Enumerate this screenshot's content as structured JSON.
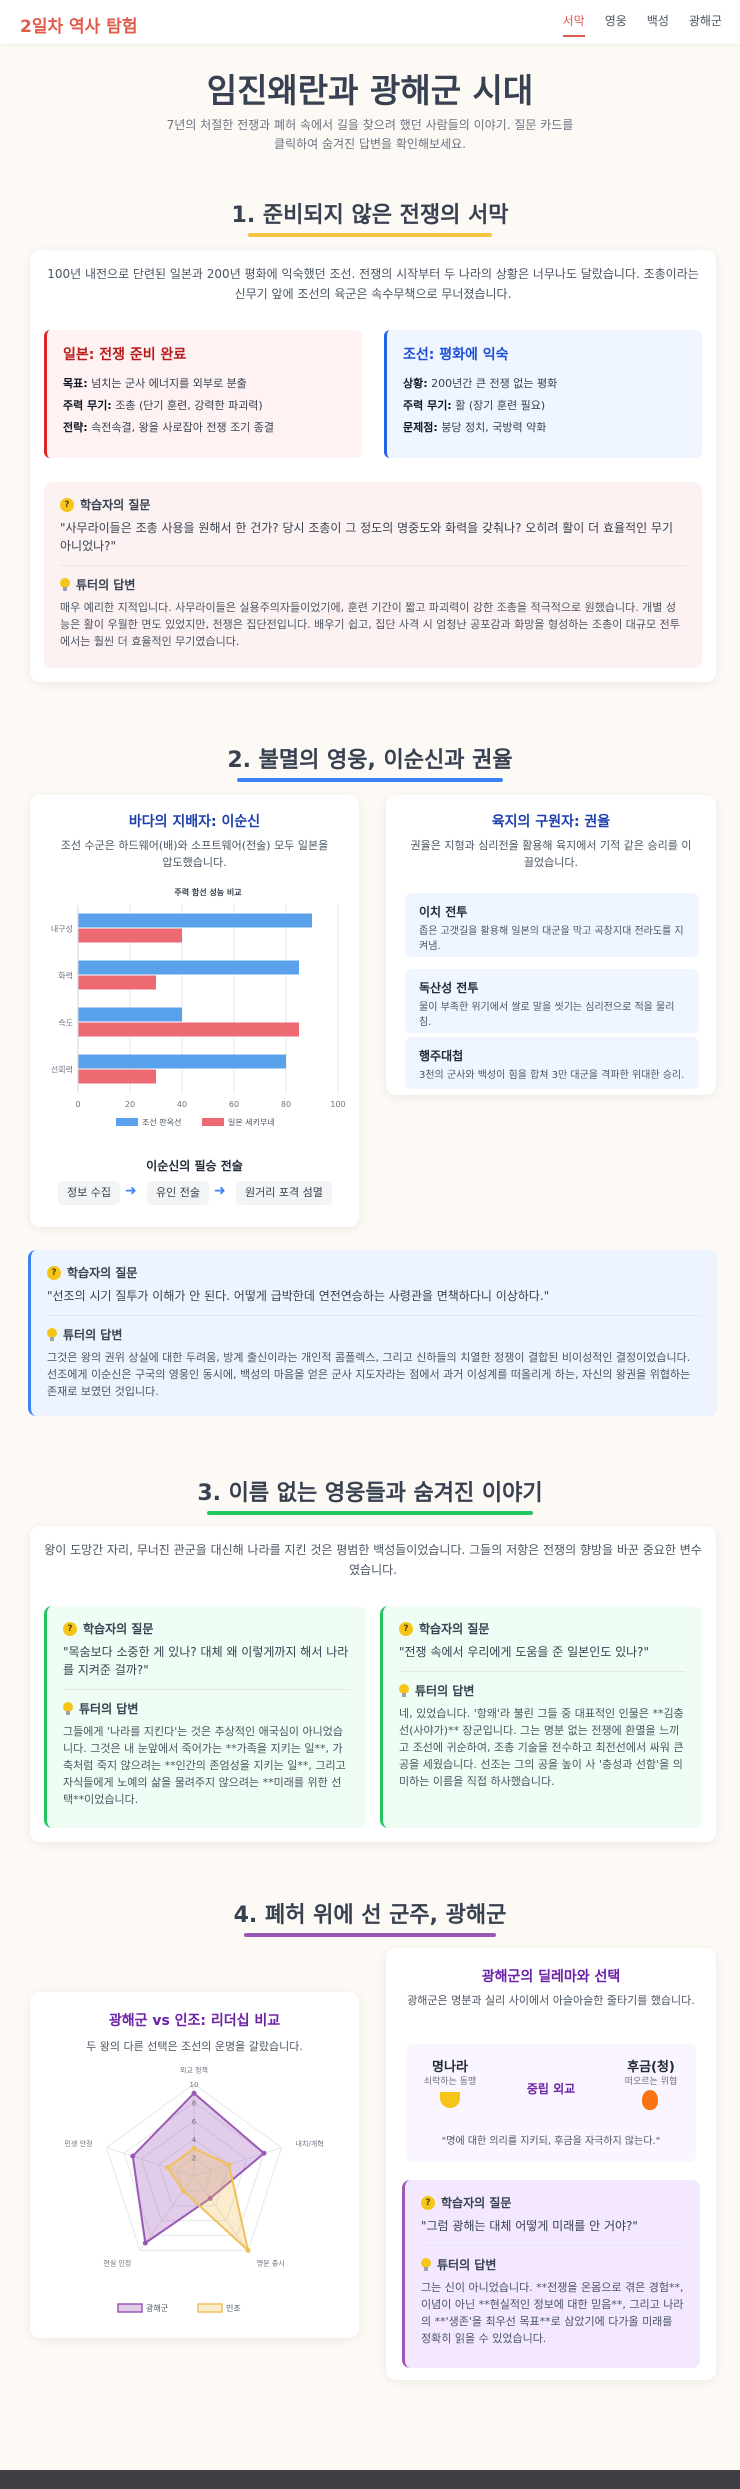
{
  "nav": {
    "brand": "2일차 역사 탐험",
    "links": [
      "서막",
      "영웅",
      "백성",
      "광해군"
    ]
  },
  "hero": {
    "title": "임진왜란과 광해군 시대",
    "subtitle": "7년의 처절한 전쟁과 폐허 속에서 길을 찾으려 했던 사람들의 이야기. 질문 카드를 클릭하여 숨겨진 답변을 확인해보세요."
  },
  "s1": {
    "title": "1. 준비되지 않은 전쟁의 서막",
    "intro": "100년 내전으로 단련된 일본과 200년 평화에 익숙했던 조선. 전쟁의 시작부터 두 나라의 상황은 너무나도 달랐습니다. 조총이라는 신무기 앞에 조선의 육군은 속수무책으로 무너졌습니다.",
    "japan": {
      "title": "일본: 전쟁 준비 완료",
      "rows": [
        [
          "목표:",
          "넘치는 군사 에너지를 외부로 분출"
        ],
        [
          "주력 무기:",
          "조총 (단기 훈련, 강력한 파괴력)"
        ],
        [
          "전략:",
          "속전속결, 왕을 사로잡아 전쟁 조기 종결"
        ]
      ]
    },
    "joseon": {
      "title": "조선: 평화에 익숙",
      "rows": [
        [
          "상황:",
          "200년간 큰 전쟁 없는 평화"
        ],
        [
          "주력 무기:",
          "활 (장기 훈련 필요)"
        ],
        [
          "문제점:",
          "붕당 정치, 국방력 약화"
        ]
      ]
    },
    "qa": {
      "q_label": "학습자의 질문",
      "q": "\"사무라이들은 조총 사용을 원해서 한 건가? 당시 조총이 그 정도의 명중도와 화력을 갖춰나? 오히려 활이 더 효율적인 무기 아니었나?\"",
      "a_label": "튜터의 답변",
      "a": "매우 예리한 지적입니다. 사무라이들은 실용주의자들이었기에, 훈련 기간이 짧고 파괴력이 강한 조총을 적극적으로 원했습니다. 개별 성능은 활이 우월한 면도 있었지만, 전쟁은 집단전입니다. 배우기 쉽고, 집단 사격 시 엄청난 공포감과 화망을 형성하는 조총이 대규모 전투에서는 훨씬 더 효율적인 무기였습니다."
    }
  },
  "s2": {
    "title": "2. 불멸의 영웅, 이순신과 권율",
    "yi": {
      "title": "바다의 지배자: 이순신",
      "desc": "조선 수군은 하드웨어(배)와 소프트웨어(전술) 모두 일본을 압도했습니다.",
      "tactics_title": "이순신의 필승 전술",
      "tactics": [
        "정보 수집",
        "유인 전술",
        "원거리 포격 섬멸"
      ]
    },
    "kwon": {
      "title": "육지의 구원자: 권율",
      "desc": "권율은 지형과 심리전을 활용해 육지에서 기적 같은 승리를 이끌었습니다.",
      "feats": [
        {
          "h": "이치 전투",
          "d": "좁은 고갯길을 활용해 일본의 대군을 막고 곡창지대 전라도를 지켜냄."
        },
        {
          "h": "독산성 전투",
          "d": "물이 부족한 위기에서 쌀로 말을 씻기는 심리전으로 적을 물리침."
        },
        {
          "h": "행주대첩",
          "d": "3천의 군사와 백성이 힘을 합쳐 3만 대군을 격파한 위대한 승리."
        }
      ]
    },
    "qa": {
      "q_label": "학습자의 질문",
      "q": "\"선조의 시기 질투가 이해가 안 된다. 어떻게 급박한데 연전연승하는 사령관을 면책하다니 이상하다.\"",
      "a_label": "튜터의 답변",
      "a": "그것은 왕의 권위 상실에 대한 두려움, 방계 출신이라는 개인적 콤플렉스, 그리고 신하들의 치열한 정쟁이 결합된 비이성적인 결정이었습니다. 선조에게 이순신은 구국의 영웅인 동시에, 백성의 마음을 얻은 군사 지도자라는 점에서 과거 이성계를 떠올리게 하는, 자신의 왕권을 위협하는 존재로 보였던 것입니다."
    }
  },
  "chart_data": [
    {
      "type": "bar",
      "orientation": "horizontal",
      "title": "주력 함선 성능 비교",
      "categories": [
        "내구성",
        "화력",
        "속도",
        "선회력"
      ],
      "series": [
        {
          "name": "조선 판옥선",
          "color": "#5aa1ec",
          "values": [
            90,
            85,
            40,
            80
          ]
        },
        {
          "name": "일본 세키부네",
          "color": "#ee6a73",
          "values": [
            40,
            30,
            85,
            30
          ]
        }
      ],
      "xlim": [
        0,
        100
      ],
      "xticks": [
        0,
        20,
        40,
        60,
        80,
        100
      ],
      "legend": "bottom"
    },
    {
      "type": "radar",
      "categories": [
        "외교 정책",
        "내치/개혁",
        "명분 중시",
        "현실 인정",
        "민생 안정"
      ],
      "rlim": [
        0,
        10
      ],
      "rticks": [
        2,
        4,
        6,
        8,
        10
      ],
      "series": [
        {
          "name": "광해군",
          "color": "#9b59b6",
          "values": [
            9,
            8,
            3,
            9,
            7
          ]
        },
        {
          "name": "인조",
          "color": "#f0c05a",
          "values": [
            3,
            4,
            10,
            2,
            3
          ]
        }
      ],
      "legend": "bottom"
    }
  ],
  "s3": {
    "title": "3. 이름 없는 영웅들과 숨겨진 이야기",
    "intro": "왕이 도망간 자리, 무너진 관군을 대신해 나라를 지킨 것은 평범한 백성들이었습니다. 그들의 저항은 전쟁의 향방을 바꾼 중요한 변수였습니다.",
    "left": {
      "q_label": "학습자의 질문",
      "q": "\"목숨보다 소중한 게 있나? 대체 왜 이렇게까지 해서 나라를 지켜준 걸까?\"",
      "a_label": "튜터의 답변",
      "a": "그들에게 '나라를 지킨다'는 것은 추상적인 애국심이 아니었습니다. 그것은 내 눈앞에서 죽어가는 **가족을 지키는 일**, 가축처럼 죽지 않으려는 **인간의 존엄성을 지키는 일**, 그리고 자식들에게 노예의 삶을 물려주지 않으려는 **미래를 위한 선택**이었습니다."
    },
    "right": {
      "q_label": "학습자의 질문",
      "q": "\"전쟁 속에서 우리에게 도움을 준 일본인도 있나?\"",
      "a_label": "튜터의 답변",
      "a": "네, 있었습니다. '항왜'라 불린 그들 중 대표적인 인물은 **김충선(사야가)** 장군입니다. 그는 명분 없는 전쟁에 환멸을 느끼고 조선에 귀순하여, 조총 기술을 전수하고 최전선에서 싸워 큰 공을 세웠습니다. 선조는 그의 공을 높이 사 '충성과 선함'을 의미하는 이름을 직접 하사했습니다."
    }
  },
  "s4": {
    "title": "4. 폐허 위에 선 군주, 광해군",
    "compare": {
      "title": "광해군 vs 인조: 리더십 비교",
      "desc": "두 왕의 다른 선택은 조선의 운명을 갈랐습니다."
    },
    "dilemma": {
      "title": "광해군의 딜레마와 선택",
      "desc": "광해군은 명분과 실리 사이에서 아슬아슬한 줄타기를 했습니다.",
      "ming": {
        "name": "명나라",
        "sub": "쇠락하는 동맹"
      },
      "middle": "중립 외교",
      "jin": {
        "name": "후금(청)",
        "sub": "떠오르는 위협"
      },
      "quote": "\"명에 대한 의리를 지키되, 후금을 자극하지 않는다.\""
    },
    "qa": {
      "q_label": "학습자의 질문",
      "q": "\"그럼 광해는 대체 어떻게 미래를 안 거야?\"",
      "a_label": "튜터의 답변",
      "a": "그는 신이 아니었습니다. **전쟁을 온몸으로 겪은 경험**, 이념이 아닌 **현실적인 정보에 대한 믿음**, 그리고 나라의 **'생존'을 최우선 목표**로 삼았기에 다가올 미래를 정확히 읽을 수 있었습니다."
    }
  }
}
